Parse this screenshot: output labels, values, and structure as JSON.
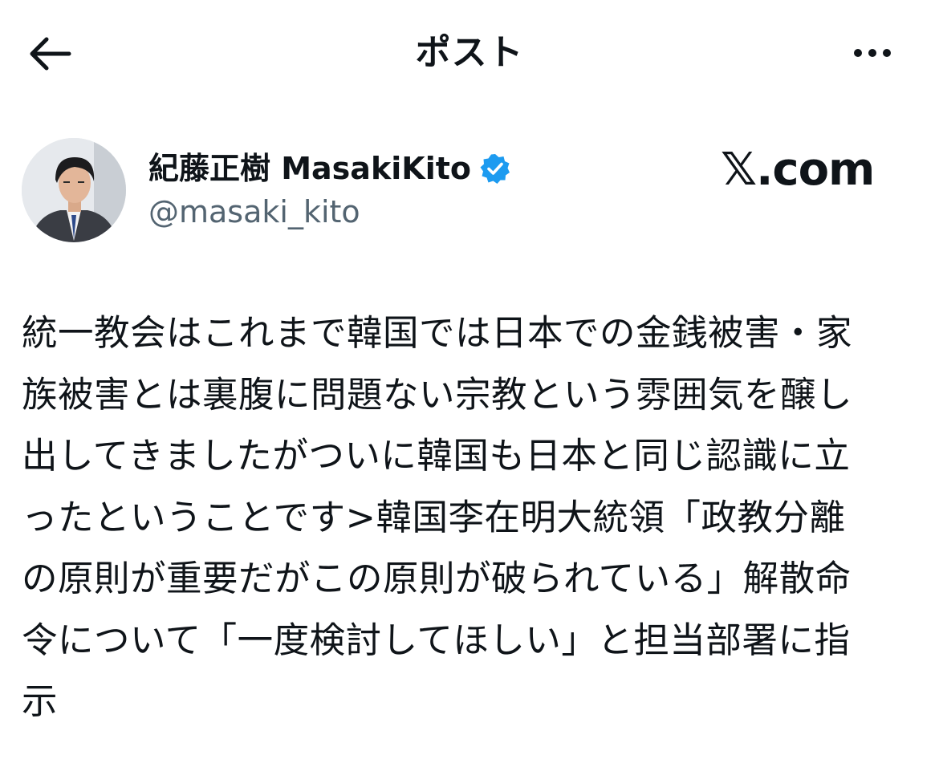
{
  "header": {
    "title": "ポスト",
    "back_icon": "arrow-left-icon",
    "more_icon": "more-horizontal-icon"
  },
  "author": {
    "display_name": "紀藤正樹 MasakiKito",
    "handle": "@masaki_kito",
    "verified": true,
    "verified_color": "#1d9bf0"
  },
  "brand": {
    "label": "𝕏.com"
  },
  "post": {
    "text": "統一教会はこれまで韓国では日本での金銭被害・家\n族被害とは裏腹に問題ない宗教という雰囲気を醸し\n出してきましたがついに韓国も日本と同じ認識に立\nったということです>韓国李在明大統領「政教分離\nの原則が重要だがこの原則が破られている」解散命\n令について「一度検討してほしい」と担当部署に指\n示"
  },
  "colors": {
    "text": "#0f1419",
    "secondary_text": "#536471",
    "background": "#ffffff"
  }
}
